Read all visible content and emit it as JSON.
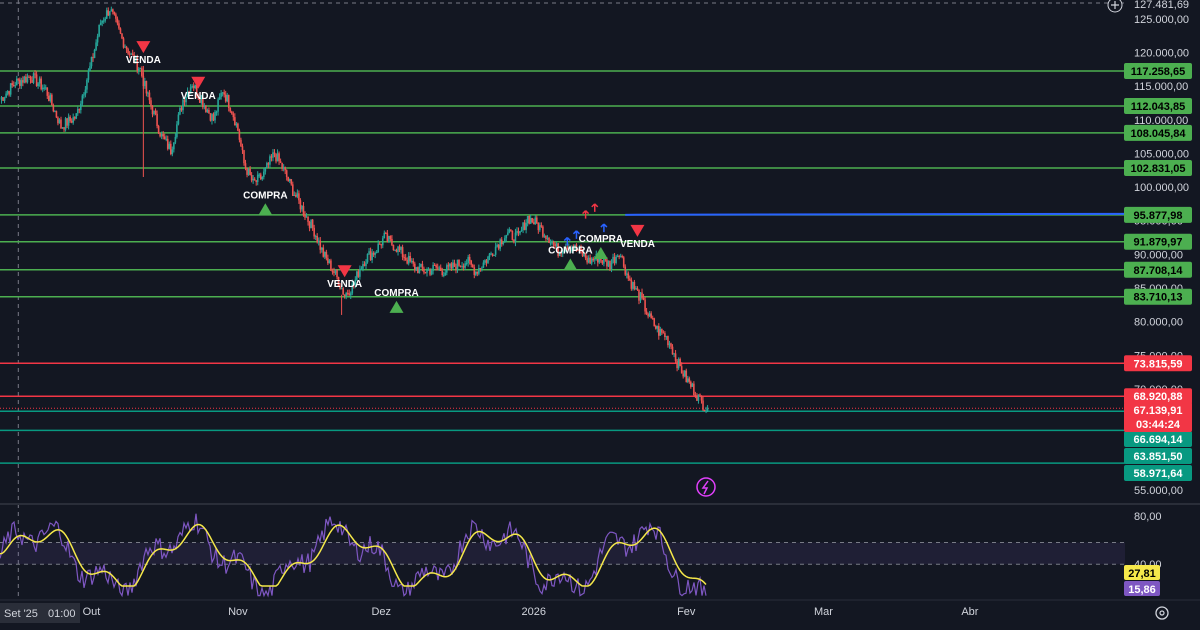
{
  "chart_data": {
    "type": "line",
    "price_axis": {
      "range": [
        53500,
        127800
      ],
      "ticks": [
        "125.000,00",
        "120.000,00",
        "115.000,00",
        "110.000,00",
        "105.000,00",
        "100.000,00",
        "95.000,00",
        "90.000,00",
        "85.000,00",
        "80.000,00",
        "75.000,00",
        "70.000,00",
        "55.000,00"
      ],
      "tick_values": [
        125000,
        120000,
        115000,
        110000,
        105000,
        100000,
        95000,
        90000,
        85000,
        80000,
        75000,
        70000,
        55000
      ],
      "top_value_label": "127.481,69"
    },
    "x_axis": {
      "start_label": "Set '25",
      "time_label": "01:00",
      "labels": [
        "Out",
        "Nov",
        "Dez",
        "2026",
        "Fev",
        "Mar",
        "Abr"
      ],
      "label_index": [
        30,
        78,
        125,
        175,
        225,
        270,
        318
      ],
      "total_slots": 382
    },
    "price_path": {
      "x_index": [
        0,
        5,
        10,
        15,
        20,
        25,
        30,
        33,
        36,
        40,
        43,
        46,
        48,
        50,
        53,
        56,
        60,
        63,
        66,
        70,
        73,
        76,
        78,
        80,
        83,
        86,
        90,
        93,
        96,
        100,
        103,
        106,
        110,
        113,
        116,
        118,
        120,
        123,
        126,
        130,
        133,
        136,
        140,
        143,
        146,
        150,
        153,
        156,
        160,
        163,
        166,
        170,
        173,
        176,
        180,
        183,
        186,
        190,
        193,
        196,
        200,
        203,
        206,
        210,
        213,
        216,
        218,
        220,
        222,
        225,
        228,
        230,
        232
      ],
      "values": [
        113000,
        115500,
        116500,
        114500,
        109000,
        110500,
        118500,
        124500,
        126500,
        122000,
        119500,
        117500,
        114000,
        111500,
        107500,
        105500,
        113000,
        115500,
        113000,
        110000,
        114500,
        111500,
        108500,
        103500,
        100500,
        101500,
        105000,
        102500,
        99500,
        96000,
        93500,
        90000,
        87000,
        84000,
        85500,
        88000,
        89500,
        90500,
        92500,
        91000,
        89500,
        88000,
        87500,
        88000,
        87500,
        88500,
        89000,
        87500,
        89500,
        91500,
        93000,
        92500,
        95500,
        94500,
        92500,
        90500,
        91500,
        90500,
        89000,
        89500,
        88500,
        90500,
        86500,
        83500,
        80500,
        78500,
        78000,
        76500,
        74000,
        71500,
        69500,
        68000,
        67140
      ]
    },
    "horizontal_levels": [
      {
        "value": "117.258,65",
        "num": 117258.65,
        "color": "#4caf50",
        "text_color": "#000000"
      },
      {
        "value": "112.043,85",
        "num": 112043.85,
        "color": "#4caf50",
        "text_color": "#000000"
      },
      {
        "value": "108.045,84",
        "num": 108045.84,
        "color": "#4caf50",
        "text_color": "#000000"
      },
      {
        "value": "102.831,05",
        "num": 102831.05,
        "color": "#4caf50",
        "text_color": "#000000"
      },
      {
        "value": "95.877,98",
        "num": 95877.98,
        "color": "#4caf50",
        "text_color": "#000000"
      },
      {
        "value": "91.879,97",
        "num": 91879.97,
        "color": "#4caf50",
        "text_color": "#000000"
      },
      {
        "value": "87.708,14",
        "num": 87708.14,
        "color": "#4caf50",
        "text_color": "#000000"
      },
      {
        "value": "83.710,13",
        "num": 83710.13,
        "color": "#4caf50",
        "text_color": "#000000"
      },
      {
        "value": "73.815,59",
        "num": 73815.59,
        "color": "#f23645",
        "text_color": "#ffffff"
      },
      {
        "value": "68.920,88",
        "num": 68920.88,
        "color": "#f23645",
        "text_color": "#ffffff"
      },
      {
        "value": "66.694,14",
        "num": 66694.14,
        "color": "#089981",
        "text_color": "#ffffff"
      },
      {
        "value": "63.851,50",
        "num": 63851.5,
        "color": "#089981",
        "text_color": "#ffffff"
      },
      {
        "value": "58.971,64",
        "num": 58971.64,
        "color": "#089981",
        "text_color": "#ffffff"
      }
    ],
    "current_price": {
      "value": "67.139,91",
      "num": 67139.91,
      "countdown": "03:44:24",
      "color": "#f23645"
    },
    "signals": [
      {
        "type": "sell",
        "label": "VENDA",
        "x_index": 47,
        "price": 120500
      },
      {
        "type": "sell",
        "label": "VENDA",
        "x_index": 65,
        "price": 115200
      },
      {
        "type": "buy",
        "label": "COMPRA",
        "x_index": 87,
        "price": 97000
      },
      {
        "type": "sell",
        "label": "VENDA",
        "x_index": 113,
        "price": 87200
      },
      {
        "type": "buy",
        "label": "COMPRA",
        "x_index": 130,
        "price": 82500
      },
      {
        "type": "buy",
        "label": "COMPRA",
        "x_index": 187,
        "price": 88800
      },
      {
        "type": "buy",
        "label": "COMPRA",
        "x_index": 197,
        "price": 90500
      },
      {
        "type": "sell",
        "label": "VENDA",
        "x_index": 209,
        "price": 93200
      }
    ],
    "oscillator": {
      "range": [
        12,
        85
      ],
      "ticks": [
        "80,00",
        "40,00"
      ],
      "tick_values": [
        80,
        40
      ],
      "band": [
        40,
        58
      ],
      "last_labels": [
        {
          "value": "27,81",
          "color": "#f5e84a",
          "text_color": "#000000"
        },
        {
          "value": "15,86",
          "color": "#7e57c2",
          "text_color": "#ffffff"
        }
      ]
    }
  }
}
